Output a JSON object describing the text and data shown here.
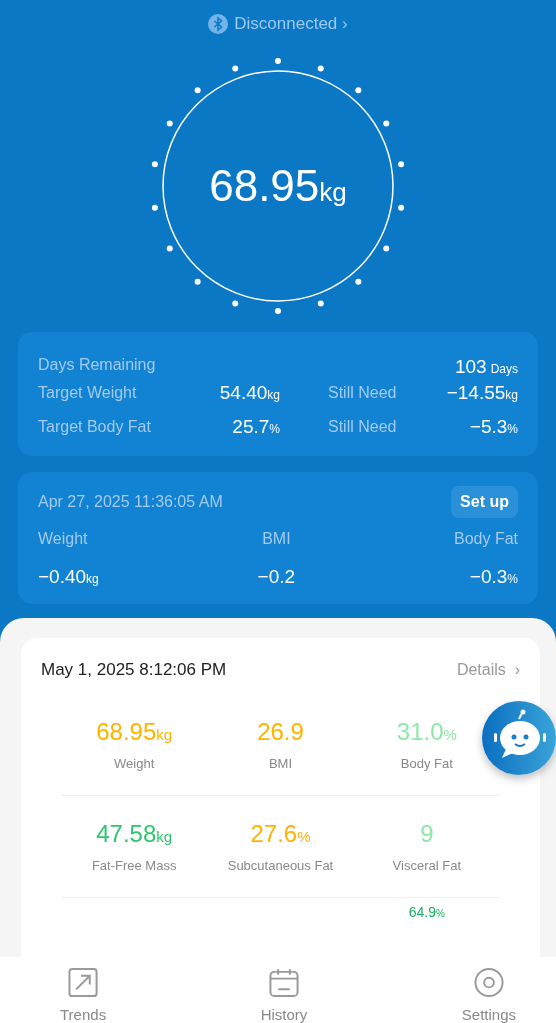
{
  "connection": {
    "label": "Disconnected",
    "arrow": "›"
  },
  "weight": {
    "value": "68.95",
    "unit": "kg"
  },
  "goal_card": {
    "days": {
      "label": "Days Remaining",
      "value": "103",
      "unit": "Days"
    },
    "rows": [
      {
        "label": "Target Weight",
        "value": "54.40",
        "unit": "kg",
        "need_label": "Still Need",
        "need_value": "−14.55",
        "need_unit": "kg"
      },
      {
        "label": "Target Body Fat",
        "value": "25.7",
        "unit": "%",
        "need_label": "Still Need",
        "need_value": "−5.3",
        "need_unit": "%"
      }
    ]
  },
  "change_card": {
    "timestamp": "Apr 27, 2025 11:36:05 AM",
    "button": "Set up",
    "items": [
      {
        "label": "Weight",
        "value": "−0.40",
        "unit": "kg"
      },
      {
        "label": "BMI",
        "value": "−0.2"
      },
      {
        "label": "Body Fat",
        "value": "−0.3",
        "unit": "%"
      }
    ]
  },
  "measurement": {
    "timestamp": "May 1, 2025 8:12:06 PM",
    "details": "Details",
    "details_arrow": "›",
    "rows": [
      [
        {
          "value": "68.95",
          "unit": "kg",
          "label": "Weight",
          "color": "#ffb300"
        },
        {
          "value": "26.9",
          "label": "BMI",
          "color": "#ffb300"
        },
        {
          "value": "31.0",
          "unit": "%",
          "label": "Body Fat",
          "color": "#8ee8a6"
        }
      ],
      [
        {
          "value": "47.58",
          "unit": "kg",
          "label": "Fat-Free Mass",
          "color": "#2dc76d"
        },
        {
          "value": "27.6",
          "unit": "%",
          "label": "Subcutaneous Fat",
          "color": "#ffb300"
        },
        {
          "value": "9",
          "label": "Visceral Fat",
          "color": "#8ee8a6"
        }
      ]
    ],
    "partial": {
      "value": "64.9",
      "unit": "%",
      "color": "#14b05e"
    }
  },
  "nav": [
    {
      "label": "Trends",
      "kind": "trends"
    },
    {
      "label": "History",
      "kind": "history"
    },
    {
      "label": "Settings",
      "kind": "settings"
    }
  ]
}
